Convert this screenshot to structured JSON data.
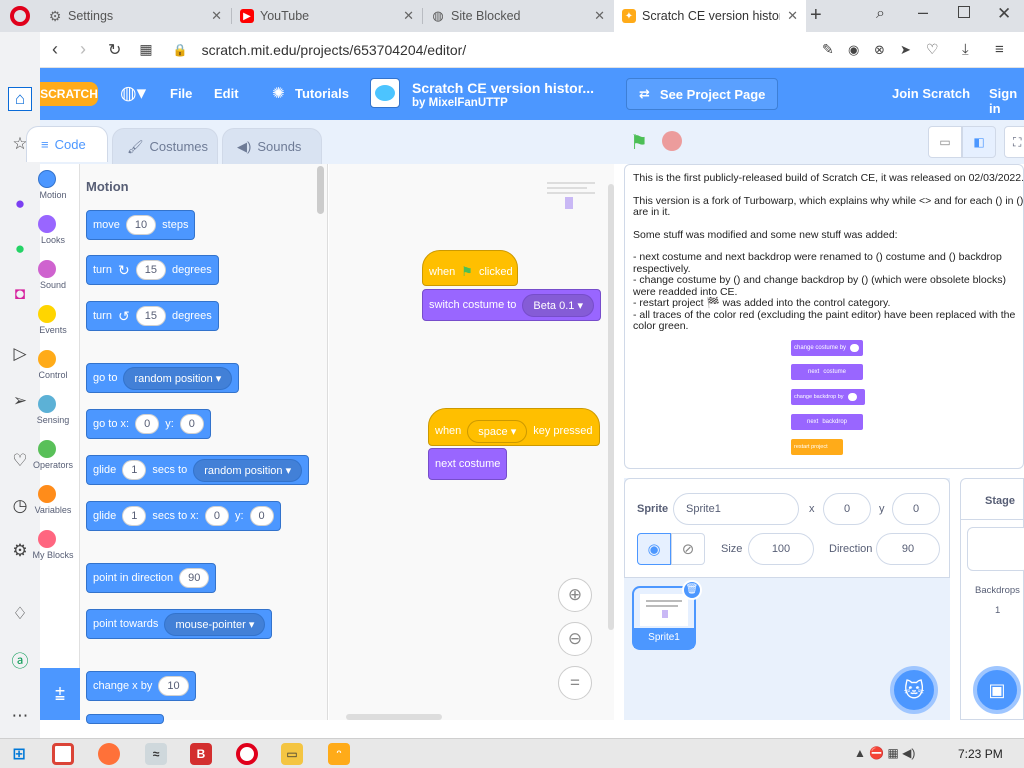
{
  "browser": {
    "tabs": [
      {
        "label": "Settings",
        "icon": "gear-icon"
      },
      {
        "label": "YouTube",
        "icon": "youtube-icon"
      },
      {
        "label": "Site Blocked",
        "icon": "globe-icon"
      },
      {
        "label": "Scratch CE version history",
        "icon": "scratch-icon"
      }
    ],
    "url": "scratch.mit.edu/projects/653704204/editor/"
  },
  "menubar": {
    "logo": "SCRATCH",
    "file": "File",
    "edit": "Edit",
    "tutorials": "Tutorials",
    "project_title": "Scratch CE version histor...",
    "author": "by MixelFanUTTP",
    "see_project": "See Project Page",
    "join": "Join Scratch",
    "signin": "Sign in"
  },
  "tabs": {
    "code": "Code",
    "costumes": "Costumes",
    "sounds": "Sounds"
  },
  "categories": [
    "Motion",
    "Looks",
    "Sound",
    "Events",
    "Control",
    "Sensing",
    "Operators",
    "Variables",
    "My Blocks"
  ],
  "category_colors": [
    "#4c97ff",
    "#9966ff",
    "#cf63cf",
    "#ffbf00",
    "#ffab19",
    "#5cb1d6",
    "#59c059",
    "#ff8c1a",
    "#ff6680"
  ],
  "palette": {
    "heading": "Motion",
    "move": {
      "a": "move",
      "n": "10",
      "b": "steps"
    },
    "turn_right": {
      "a": "turn",
      "n": "15",
      "b": "degrees"
    },
    "turn_left": {
      "a": "turn",
      "n": "15",
      "b": "degrees"
    },
    "goto": {
      "a": "go to",
      "d": "random position"
    },
    "gotoxy": {
      "a": "go to x:",
      "x": "0",
      "b": "y:",
      "y": "0"
    },
    "glide": {
      "a": "glide",
      "n": "1",
      "b": "secs to",
      "d": "random position"
    },
    "glidexy": {
      "a": "glide",
      "n": "1",
      "b": "secs to x:",
      "x": "0",
      "c": "y:",
      "y": "0"
    },
    "point_dir": {
      "a": "point in direction",
      "n": "90"
    },
    "point_towards": {
      "a": "point towards",
      "d": "mouse-pointer"
    },
    "changex": {
      "a": "change x by",
      "n": "10"
    }
  },
  "script1": {
    "when": "when",
    "clicked": "clicked",
    "switch": "switch costume to",
    "costume": "Beta 0.1"
  },
  "script2": {
    "when": "when",
    "key": "space",
    "pressed": "key pressed",
    "next": "next costume"
  },
  "stage_text": {
    "p1": "This is the first publicly-released build of Scratch CE, it was released on 02/03/2022.",
    "p2": "This version is a fork of Turbowarp, which explains why while <> and for each () in () are in it.",
    "p3": "Some stuff was modified and some new stuff was added:",
    "l1": "- next costume and next backdrop were renamed to () costume and () backdrop respectively.",
    "l2": "- change costume by () and change backdrop by () (which were obsolete blocks) were readded into CE.",
    "l3": "- restart project 🏁 was added into the control category.",
    "l4": "- all traces of the color red (excluding the paint editor) have been replaced with the color green.",
    "b1": "change costume by",
    "b2": "next",
    "b2b": "costume",
    "b3": "change backdrop by",
    "b4": "next",
    "b4b": "backdrop",
    "b5": "restart project"
  },
  "sprite": {
    "label": "Sprite",
    "name": "Sprite1",
    "x_label": "x",
    "x": "0",
    "y_label": "y",
    "y": "0",
    "size_label": "Size",
    "size": "100",
    "dir_label": "Direction",
    "dir": "90",
    "thumb": "Sprite1"
  },
  "stage_panel": {
    "title": "Stage",
    "backdrops": "Backdrops",
    "count": "1"
  },
  "taskbar": {
    "time": "7:23 PM"
  }
}
